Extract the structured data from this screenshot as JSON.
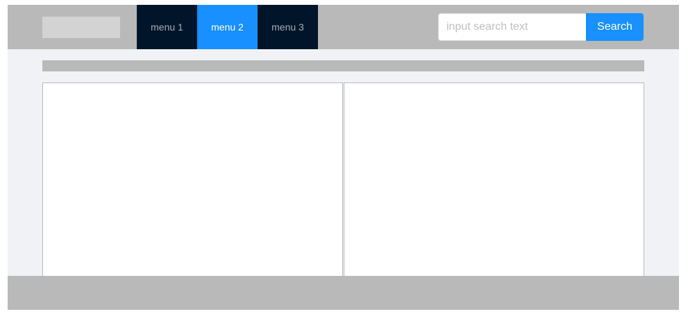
{
  "header": {
    "menu": [
      {
        "label": "menu 1",
        "active": false
      },
      {
        "label": "menu 2",
        "active": true
      },
      {
        "label": "menu 3",
        "active": false
      }
    ],
    "search": {
      "placeholder": "input search text",
      "value": "",
      "button_label": "Search"
    }
  },
  "colors": {
    "header_bg": "#b9b9b9",
    "menu_bg": "#001529",
    "accent": "#1890ff",
    "page_bg": "#f0f2f5",
    "panel_bg": "#ffffff"
  }
}
